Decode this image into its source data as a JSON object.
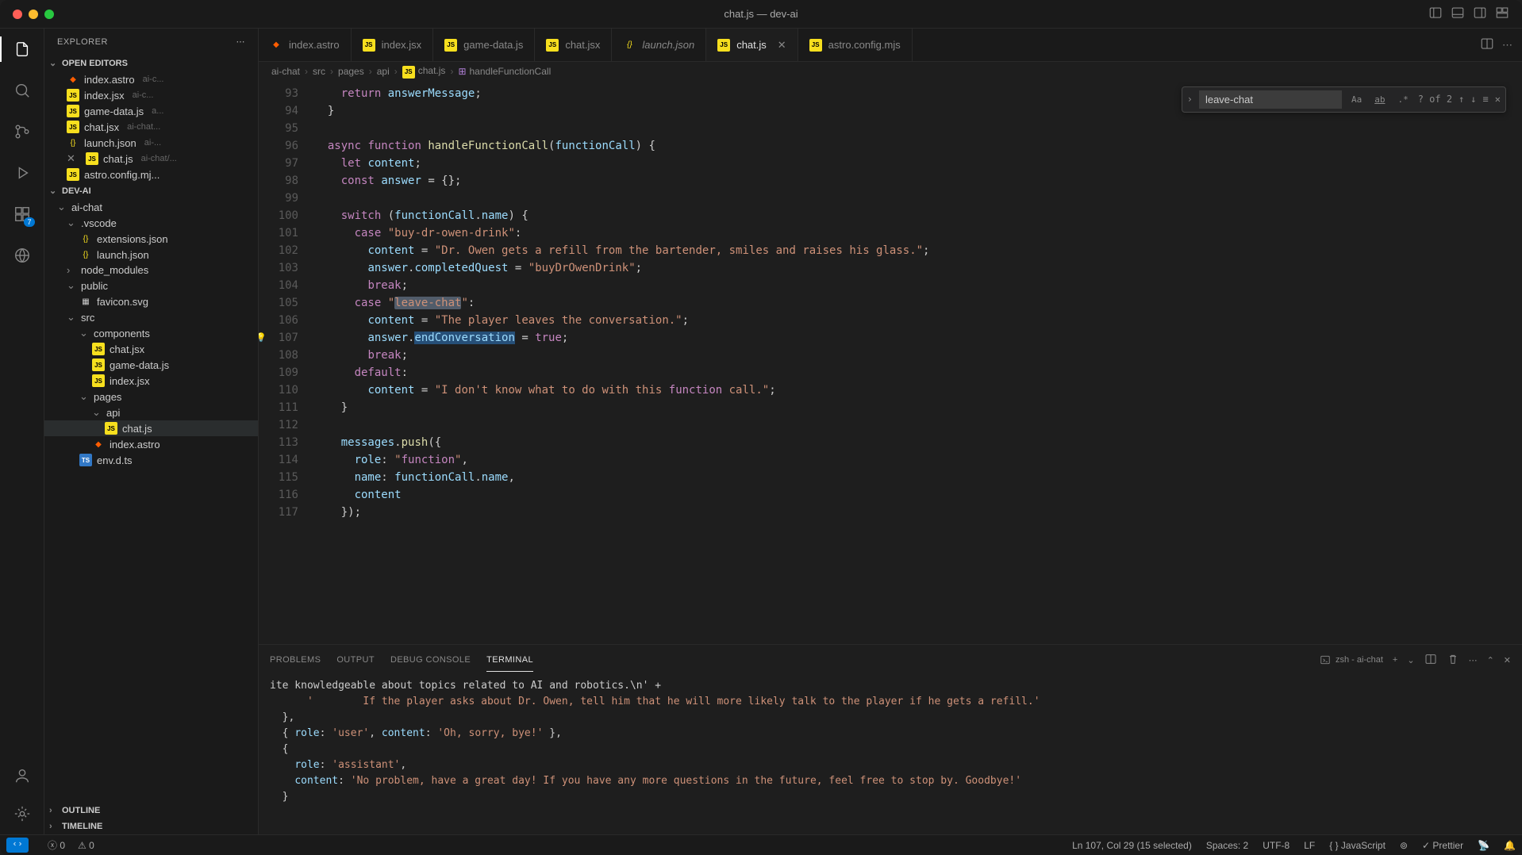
{
  "window": {
    "title": "chat.js — dev-ai"
  },
  "sidebar": {
    "header": "EXPLORER",
    "sections": {
      "openEditors": "OPEN EDITORS",
      "workspace": "DEV-AI",
      "outline": "OUTLINE",
      "timeline": "TIMELINE"
    },
    "openEditors": [
      {
        "name": "index.astro",
        "desc": "ai-c..."
      },
      {
        "name": "index.jsx",
        "desc": "ai-c..."
      },
      {
        "name": "game-data.js",
        "desc": "a..."
      },
      {
        "name": "chat.jsx",
        "desc": "ai-chat..."
      },
      {
        "name": "launch.json",
        "desc": "ai-..."
      },
      {
        "name": "chat.js",
        "desc": "ai-chat/..."
      },
      {
        "name": "astro.config.mj...",
        "desc": ""
      }
    ],
    "tree": [
      {
        "name": "ai-chat",
        "type": "folder",
        "depth": 0,
        "open": true
      },
      {
        "name": ".vscode",
        "type": "folder",
        "depth": 1,
        "open": true
      },
      {
        "name": "extensions.json",
        "type": "json",
        "depth": 2
      },
      {
        "name": "launch.json",
        "type": "json",
        "depth": 2
      },
      {
        "name": "node_modules",
        "type": "folder",
        "depth": 1,
        "open": false
      },
      {
        "name": "public",
        "type": "folder",
        "depth": 1,
        "open": true
      },
      {
        "name": "favicon.svg",
        "type": "svg",
        "depth": 2
      },
      {
        "name": "src",
        "type": "folder",
        "depth": 1,
        "open": true
      },
      {
        "name": "components",
        "type": "folder",
        "depth": 2,
        "open": true
      },
      {
        "name": "chat.jsx",
        "type": "js",
        "depth": 3
      },
      {
        "name": "game-data.js",
        "type": "js",
        "depth": 3
      },
      {
        "name": "index.jsx",
        "type": "js",
        "depth": 3
      },
      {
        "name": "pages",
        "type": "folder",
        "depth": 2,
        "open": true
      },
      {
        "name": "api",
        "type": "folder",
        "depth": 3,
        "open": true
      },
      {
        "name": "chat.js",
        "type": "js",
        "depth": 4,
        "sel": true
      },
      {
        "name": "index.astro",
        "type": "astro",
        "depth": 3
      },
      {
        "name": "env.d.ts",
        "type": "ts",
        "depth": 2
      }
    ]
  },
  "tabs": [
    {
      "label": "index.astro",
      "icon": "astro"
    },
    {
      "label": "index.jsx",
      "icon": "js"
    },
    {
      "label": "game-data.js",
      "icon": "js"
    },
    {
      "label": "chat.jsx",
      "icon": "js"
    },
    {
      "label": "launch.json",
      "icon": "json",
      "italic": true
    },
    {
      "label": "chat.js",
      "icon": "js",
      "active": true
    },
    {
      "label": "astro.config.mjs",
      "icon": "js"
    }
  ],
  "breadcrumb": [
    "ai-chat",
    "src",
    "pages",
    "api",
    "chat.js",
    "handleFunctionCall"
  ],
  "find": {
    "value": "leave-chat",
    "count": "? of 2"
  },
  "code": {
    "startLine": 93,
    "lines": [
      "    return answerMessage;",
      "  }",
      "",
      "  async function handleFunctionCall(functionCall) {",
      "    let content;",
      "    const answer = {};",
      "",
      "    switch (functionCall.name) {",
      "      case \"buy-dr-owen-drink\":",
      "        content = \"Dr. Owen gets a refill from the bartender, smiles and raises his glass.\";",
      "        answer.completedQuest = \"buyDrOwenDrink\";",
      "        break;",
      "      case \"leave-chat\":",
      "        content = \"The player leaves the conversation.\";",
      "        answer.endConversation = true;",
      "        break;",
      "      default:",
      "        content = \"I don't know what to do with this function call.\";",
      "    }",
      "",
      "    messages.push({",
      "      role: \"function\",",
      "      name: functionCall.name,",
      "      content",
      "    });"
    ],
    "bulbLine": 107
  },
  "panel": {
    "tabs": [
      "PROBLEMS",
      "OUTPUT",
      "DEBUG CONSOLE",
      "TERMINAL"
    ],
    "active": "TERMINAL",
    "shell": "zsh - ai-chat",
    "lines": [
      "ite knowledgeable about topics related to AI and robotics.\\n' +",
      "      '        If the player asks about Dr. Owen, tell him that he will more likely talk to the player if he gets a refill.'",
      "  },",
      "  { role: 'user', content: 'Oh, sorry, bye!' },",
      "  {",
      "    role: 'assistant',",
      "    content: 'No problem, have a great day! If you have any more questions in the future, feel free to stop by. Goodbye!'",
      "  }"
    ]
  },
  "status": {
    "errors": "0",
    "warnings": "0",
    "pos": "Ln 107, Col 29 (15 selected)",
    "spaces": "Spaces: 2",
    "enc": "UTF-8",
    "eol": "LF",
    "lang": "JavaScript",
    "prettier": "Prettier"
  },
  "activity": {
    "badge": "7"
  }
}
